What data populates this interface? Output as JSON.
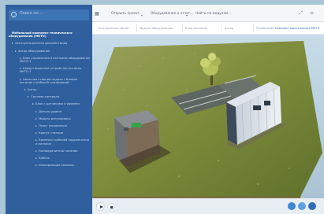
{
  "sidebar": {
    "search_placeholder": "Поиск по ...",
    "items": [
      {
        "label": "Мобильный комплекс технического оборудования (МКТО)",
        "bold": true
      },
      {
        "label": "Эксплуатационная документация"
      },
      {
        "label": "Ангар оборудования"
      },
      {
        "label": "Блок управления и контроля оборудования МКТО-1"
      },
      {
        "label": "Коммутационное устройство питания МКТО-1"
      },
      {
        "label": "Насосная станция подачи с блоком питания и рабочей платформой"
      },
      {
        "label": "Ангар"
      },
      {
        "label": "Система контроля"
      },
      {
        "label": "Блок с датчиками и уровнем"
      },
      {
        "label": "Датчик уровня"
      },
      {
        "label": "Модуль регулировки"
      },
      {
        "label": "Пульт управления"
      },
      {
        "label": "Корпус станции"
      },
      {
        "label": "Комплект кабелей подключения и питания"
      },
      {
        "label": "Распределитель питания"
      },
      {
        "label": "Кабель"
      },
      {
        "label": "Изолирующие колонки"
      }
    ]
  },
  "toolbar": {
    "grid_icon": "grid-icon",
    "open_label": "Открыть проект...",
    "tool_label": "Оборудование и отчет...",
    "search_label": "Найти по модулям..."
  },
  "filters": {
    "items": [
      "Контрольные линии",
      "Модуль оборудования",
      "Блок датчиков",
      "Ангар",
      "Управление"
    ],
    "active": "Комплектация изделия МКТО"
  },
  "bottom": {
    "play_icon": "play-icon",
    "stop_icon": "stop-icon"
  },
  "colors": {
    "sidebar": "#2f5f9d",
    "accent": "#2f6db5",
    "grass": "#7f8f3e",
    "container": "#e6ecf1"
  }
}
